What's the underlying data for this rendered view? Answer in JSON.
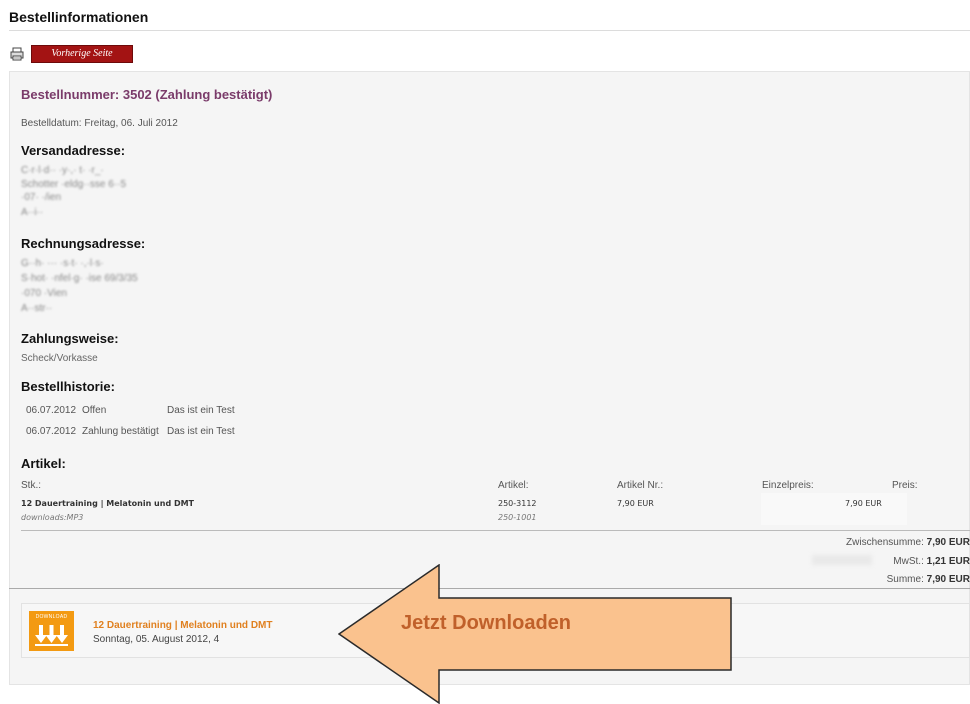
{
  "page": {
    "title": "Bestellinformationen",
    "prev_button": "Vorherige Seite",
    "print_icon": "printer-icon"
  },
  "order": {
    "title": "Bestellnummer: 3502 (Zahlung bestätigt)",
    "date": "Bestelldatum: Freitag, 06. Juli 2012"
  },
  "shipping": {
    "heading": "Versandadresse:",
    "lines": [
      "C·r·l·d·· ·y·,· t· ·r_·",
      "Schotter ·eldg··sse 6··5",
      "·07· ·/ien",
      "A··i··"
    ]
  },
  "billing": {
    "heading": "Rechnungsadresse:",
    "lines": [
      "G··h· ··· ·s·t· ·,·l·s·",
      "S·hot· ·nfel·g· ·ise 69/3/35",
      "·070 ·Vien",
      "A··str··"
    ]
  },
  "payment": {
    "heading": "Zahlungsweise:",
    "method": "Scheck/Vorkasse"
  },
  "history": {
    "heading": "Bestellhistorie:",
    "rows": [
      {
        "date": "06.07.2012",
        "status": "Offen",
        "comment": "Das ist ein Test"
      },
      {
        "date": "06.07.2012",
        "status": "Zahlung bestätigt",
        "comment": "Das ist ein Test"
      }
    ]
  },
  "articles": {
    "heading": "Artikel:",
    "columns": {
      "qty": "Stk.:",
      "article": "Artikel:",
      "article_no": "Artikel Nr.:",
      "unit_price": "Einzelpreis:",
      "price": "Preis:"
    },
    "item": {
      "name": "12 Dauertraining | Melatonin und DMT",
      "sub": "downloads:MP3",
      "article": "250-3112",
      "article_sub": "250-1001",
      "article_no": "7,90 EUR",
      "price": "7,90 EUR"
    }
  },
  "totals": {
    "subtotal_label": "Zwischensumme:",
    "subtotal": "7,90 EUR",
    "tax_label": "MwSt.:",
    "tax": "1,21 EUR",
    "total_label": "Summe:",
    "total": "7,90 EUR"
  },
  "download": {
    "icon_label": "DOWNLOAD",
    "title": "12 Dauertraining | Melatonin und DMT",
    "date": "Sonntag, 05. August 2012, 4",
    "callout": "Jetzt Downloaden"
  },
  "colors": {
    "accent_red": "#a31313",
    "order_title": "#7a3b6a",
    "download_orange": "#f39a12",
    "arrow_fill": "#fac28e"
  }
}
